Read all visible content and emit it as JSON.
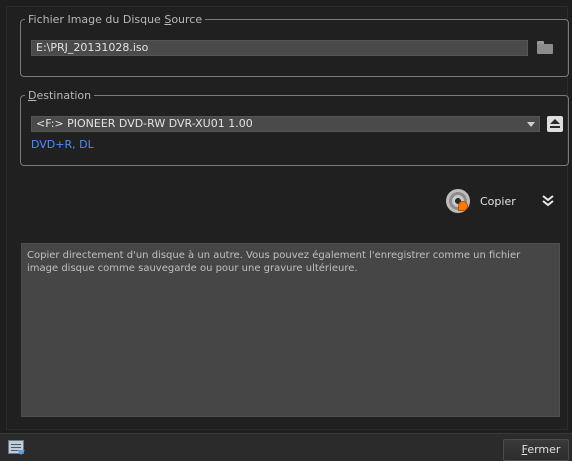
{
  "source_group": {
    "legend_prefix": "Fichier Image du Disque ",
    "legend_accel": "S",
    "legend_suffix": "ource",
    "path_value": "E:\\PRJ_20131028.iso"
  },
  "destination_group": {
    "legend_accel": "D",
    "legend_suffix": "estination",
    "selected_drive": "<F:>  PIONEER DVD-RW DVR-XU01 1.00",
    "media_type": "DVD+R, DL"
  },
  "actions": {
    "copy_label": "Copier"
  },
  "description": "Copier directement d'un disque à un autre. Vous pouvez également l'enregistrer comme un fichier image disque comme sauvegarde ou pour une gravure ultérieure.",
  "footer": {
    "close_accel": "F",
    "close_suffix": "ermer"
  },
  "icons": {
    "folder": "folder-icon",
    "eject": "eject-icon",
    "disc_copy": "disc-copy-icon",
    "expand": "double-chevron-down-icon",
    "log": "log-icon"
  },
  "colors": {
    "accent_link": "#4a8cff",
    "field_bg": "#4a4a4a",
    "description_bg": "#464646"
  }
}
